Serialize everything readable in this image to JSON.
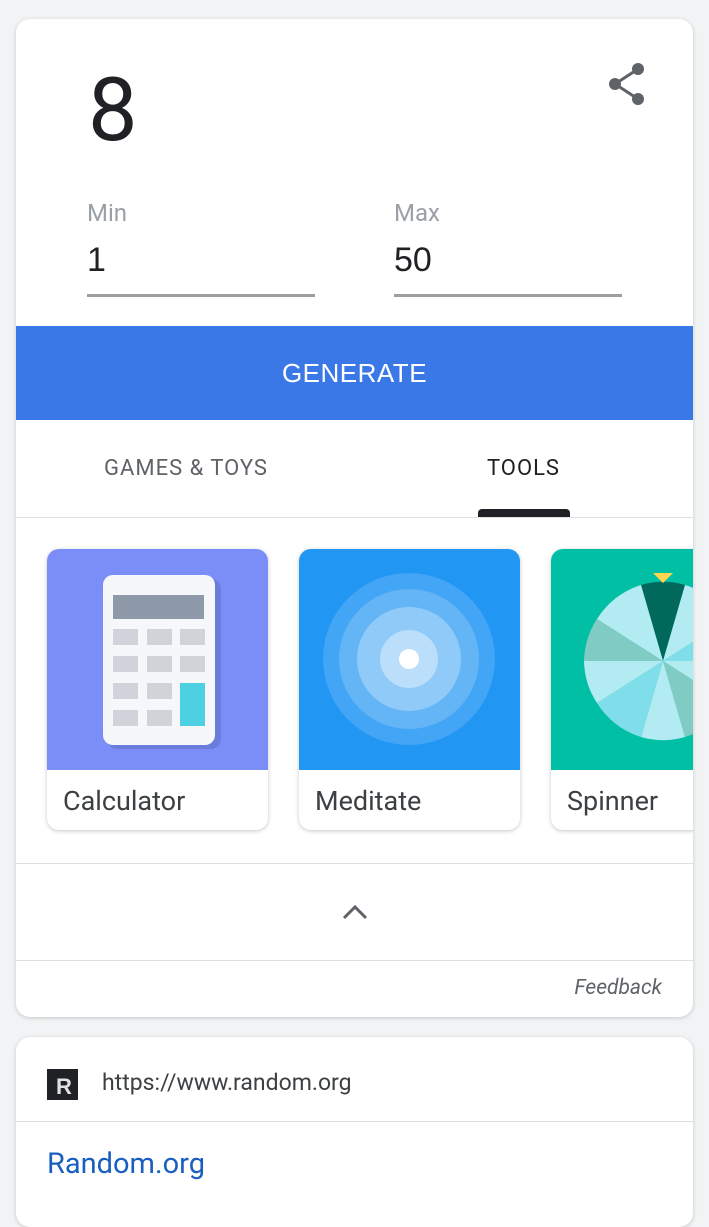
{
  "rng": {
    "result": "8",
    "min_label": "Min",
    "min_value": "1",
    "max_label": "Max",
    "max_value": "50",
    "generate_label": "GENERATE"
  },
  "tabs": [
    {
      "label": "GAMES & TOYS",
      "selected": false
    },
    {
      "label": "TOOLS",
      "selected": true
    }
  ],
  "tools": [
    {
      "label": "Calculator",
      "icon": "calculator-icon",
      "bg": "#7b8ef7"
    },
    {
      "label": "Meditate",
      "icon": "meditate-icon",
      "bg": "#2196f3"
    },
    {
      "label": "Spinner",
      "icon": "spinner-wheel-icon",
      "bg": "#00bfa5"
    }
  ],
  "feedback_label": "Feedback",
  "result_site": {
    "url": "https://www.random.org",
    "title": "Random.org",
    "favicon_letter": "R"
  },
  "colors": {
    "accent": "#3b78e7",
    "link": "#1a5fbf"
  }
}
